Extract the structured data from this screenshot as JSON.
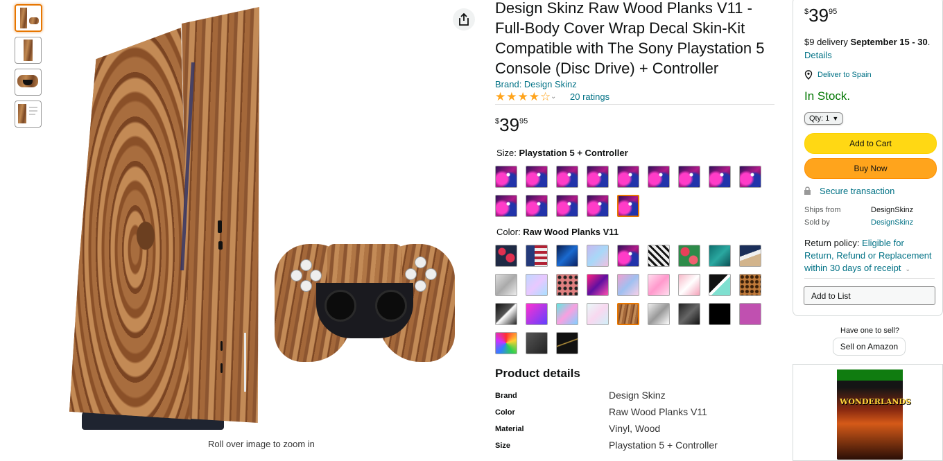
{
  "thumbnails": [
    "console + controller",
    "console",
    "controller",
    "product card"
  ],
  "main_image": {
    "caption": "Roll over image to zoom in"
  },
  "product": {
    "title": "Design Skinz Raw Wood Planks V11 - Full-Body Cover Wrap Decal Skin-Kit Compatible with The Sony Playstation 5 Console (Disc Drive) + Controller",
    "brand_link": "Brand: Design Skinz",
    "rating_stars": 4,
    "rating_glyphs": "★★★★☆",
    "ratings_count": "20 ratings",
    "price_symbol": "$",
    "price_whole": "39",
    "price_fraction": "95",
    "size_label": "Size: ",
    "size_value": "Playstation 5 + Controller",
    "color_label": "Color: ",
    "color_value": "Raw Wood Planks V11"
  },
  "product_details": {
    "heading": "Product details",
    "rows": [
      {
        "key": "Brand",
        "value": "Design Skinz"
      },
      {
        "key": "Color",
        "value": "Raw Wood Planks V11"
      },
      {
        "key": "Material",
        "value": "Vinyl, Wood"
      },
      {
        "key": "Size",
        "value": "Playstation 5 + Controller"
      }
    ]
  },
  "buybox": {
    "price_symbol": "$",
    "price_whole": "39",
    "price_fraction": "95",
    "delivery_prefix": "$9 delivery ",
    "delivery_dates": "September 15 - 30",
    "delivery_suffix": ".",
    "details_link": "Details",
    "deliver_to": "Deliver to Spain",
    "stock": "In Stock.",
    "qty_label": "Qty: 1",
    "add_to_cart": "Add to Cart",
    "buy_now": "Buy Now",
    "secure": "Secure transaction",
    "ships_from_label": "Ships from",
    "ships_from_value": "DesignSkinz",
    "sold_by_label": "Sold by",
    "sold_by_value": "DesignSkinz",
    "return_prefix": "Return policy: ",
    "return_link": "Eligible for Return, Refund or Replacement within 30 days of receipt",
    "add_to_list": "Add to List",
    "have_one": "Have one to sell?",
    "sell_on_amazon": "Sell on Amazon"
  },
  "ad": {
    "game_title": "WONDERLANDS"
  },
  "colors": {
    "link": "#007185",
    "stock_green": "#007600",
    "cart_yellow": "#ffd814",
    "buy_orange": "#ffa41c",
    "selected_orange": "#e77600"
  }
}
